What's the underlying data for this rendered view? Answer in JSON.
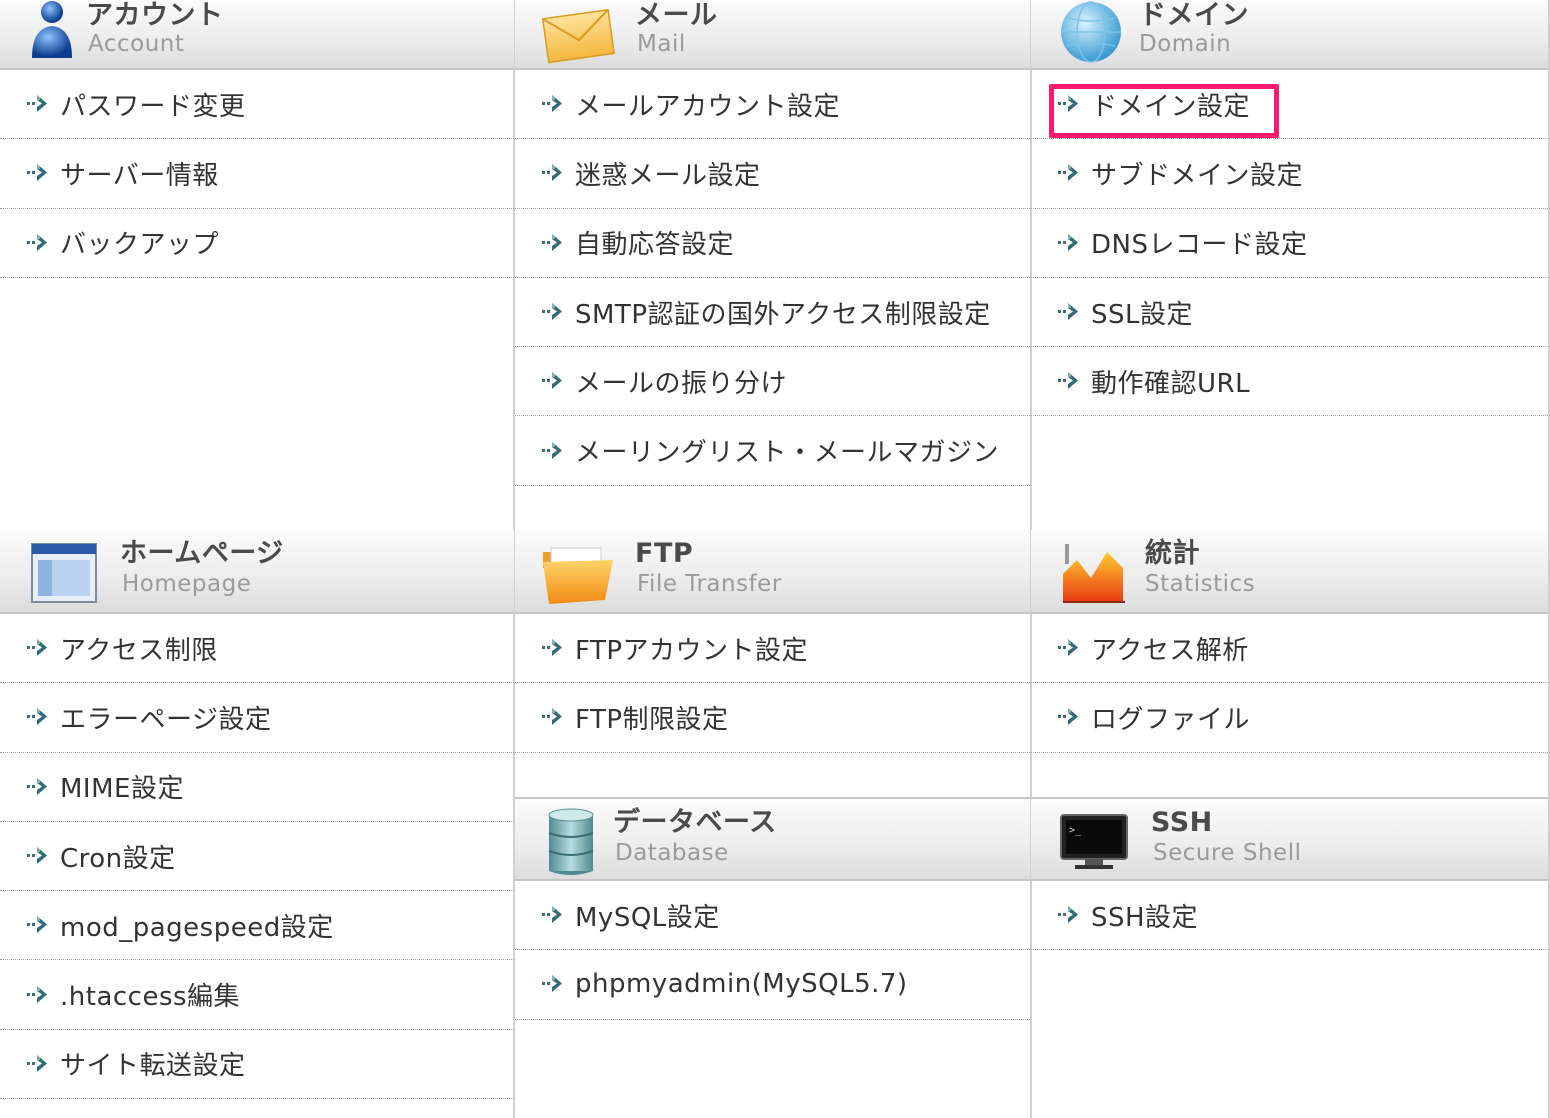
{
  "highlight_color": "#ff1a6e",
  "columns": [
    {
      "panels": [
        {
          "icon": "account-person-icon",
          "title": "アカウント",
          "subtitle": "Account",
          "items": [
            "パスワード変更",
            "サーバー情報",
            "バックアップ"
          ]
        },
        {
          "icon": "homepage-window-icon",
          "title": "ホームページ",
          "subtitle": "Homepage",
          "items": [
            "アクセス制限",
            "エラーページ設定",
            "MIME設定",
            "Cron設定",
            "mod_pagespeed設定",
            ".htaccess編集",
            "サイト転送設定"
          ]
        }
      ]
    },
    {
      "panels": [
        {
          "icon": "mail-envelope-icon",
          "title": "メール",
          "subtitle": "Mail",
          "items": [
            "メールアカウント設定",
            "迷惑メール設定",
            "自動応答設定",
            "SMTP認証の国外アクセス制限設定",
            "メールの振り分け",
            "メーリングリスト・メールマガジン"
          ]
        },
        {
          "icon": "ftp-folder-icon",
          "title": "FTP",
          "subtitle": "File Transfer",
          "items": [
            "FTPアカウント設定",
            "FTP制限設定"
          ]
        },
        {
          "icon": "database-icon",
          "title": "データベース",
          "subtitle": "Database",
          "items": [
            "MySQL設定",
            "phpmyadmin(MySQL5.7)"
          ]
        }
      ]
    },
    {
      "panels": [
        {
          "icon": "domain-globe-icon",
          "title": "ドメイン",
          "subtitle": "Domain",
          "items": [
            "ドメイン設定",
            "サブドメイン設定",
            "DNSレコード設定",
            "SSL設定",
            "動作確認URL"
          ]
        },
        {
          "icon": "statistics-chart-icon",
          "title": "統計",
          "subtitle": "Statistics",
          "items": [
            "アクセス解析",
            "ログファイル"
          ]
        },
        {
          "icon": "ssh-terminal-icon",
          "title": "SSH",
          "subtitle": "Secure Shell",
          "items": [
            "SSH設定"
          ]
        }
      ]
    }
  ]
}
